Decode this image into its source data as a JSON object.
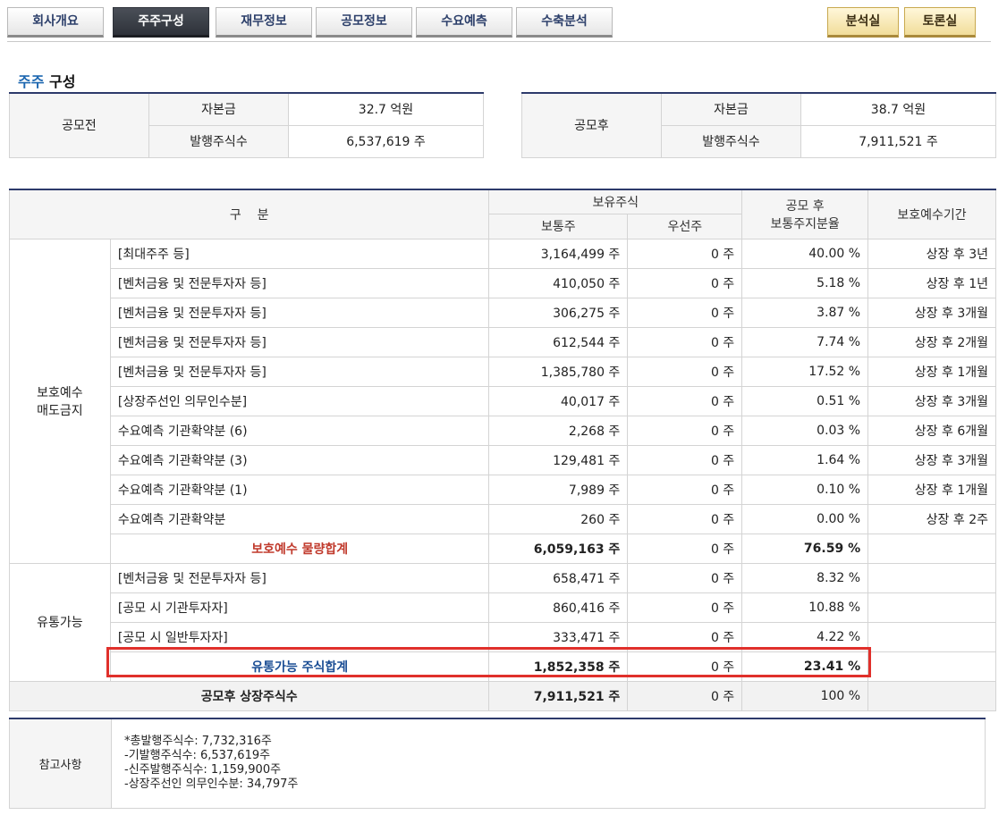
{
  "tabs": {
    "left": [
      "회사개요",
      "주주구성",
      "재무정보",
      "공모정보",
      "수요예측",
      "수축분석"
    ],
    "right": [
      "분석실",
      "토론실"
    ]
  },
  "section": {
    "title_accent": "주주",
    "title_rest": " 구성"
  },
  "before_offering": {
    "label": "공모전",
    "capital_label": "자본금",
    "capital_value": "32.7 억원",
    "shares_label": "발행주식수",
    "shares_value": "6,537,619 주"
  },
  "after_offering": {
    "label": "공모후",
    "capital_label": "자본금",
    "capital_value": "38.7 억원",
    "shares_label": "발행주식수",
    "shares_value": "7,911,521 주"
  },
  "table": {
    "headers": {
      "category": "구    분",
      "holdings": "보유주식",
      "common": "보통주",
      "preferred": "우선주",
      "ratio_line1": "공모 후",
      "ratio_line2": "보통주지분율",
      "lockup": "보호예수기간"
    },
    "lockup_group": {
      "label_line1": "보호예수",
      "label_line2": "매도금지",
      "rows": [
        {
          "name": "[최대주주 등]",
          "common": "3,164,499 주",
          "preferred": "0 주",
          "ratio": "40.00 %",
          "period": "상장 후 3년"
        },
        {
          "name": "[벤처금융 및 전문투자자 등]",
          "common": "410,050 주",
          "preferred": "0 주",
          "ratio": "5.18 %",
          "period": "상장 후 1년"
        },
        {
          "name": "[벤처금융 및 전문투자자 등]",
          "common": "306,275 주",
          "preferred": "0 주",
          "ratio": "3.87 %",
          "period": "상장 후 3개월"
        },
        {
          "name": "[벤처금융 및 전문투자자 등]",
          "common": "612,544 주",
          "preferred": "0 주",
          "ratio": "7.74 %",
          "period": "상장 후 2개월"
        },
        {
          "name": "[벤처금융 및 전문투자자 등]",
          "common": "1,385,780 주",
          "preferred": "0 주",
          "ratio": "17.52 %",
          "period": "상장 후 1개월"
        },
        {
          "name": "[상장주선인 의무인수분]",
          "common": "40,017 주",
          "preferred": "0 주",
          "ratio": "0.51 %",
          "period": "상장 후 3개월"
        },
        {
          "name": "수요예측 기관확약분 (6)",
          "common": "2,268 주",
          "preferred": "0 주",
          "ratio": "0.03 %",
          "period": "상장 후 6개월"
        },
        {
          "name": "수요예측 기관확약분 (3)",
          "common": "129,481 주",
          "preferred": "0 주",
          "ratio": "1.64 %",
          "period": "상장 후 3개월"
        },
        {
          "name": "수요예측 기관확약분 (1)",
          "common": "7,989 주",
          "preferred": "0 주",
          "ratio": "0.10 %",
          "period": "상장 후 1개월"
        },
        {
          "name": "수요예측 기관확약분",
          "common": "260 주",
          "preferred": "0 주",
          "ratio": "0.00 %",
          "period": "상장 후 2주"
        }
      ],
      "subtotal": {
        "name": "보호예수 물량합계",
        "common": "6,059,163 주",
        "preferred": "0 주",
        "ratio": "76.59 %"
      }
    },
    "tradable_group": {
      "label": "유통가능",
      "rows": [
        {
          "name": "[벤처금융 및 전문투자자 등]",
          "common": "658,471 주",
          "preferred": "0 주",
          "ratio": "8.32 %"
        },
        {
          "name": "[공모 시 기관투자자]",
          "common": "860,416 주",
          "preferred": "0 주",
          "ratio": "10.88 %"
        },
        {
          "name": "[공모 시 일반투자자]",
          "common": "333,471 주",
          "preferred": "0 주",
          "ratio": "4.22 %"
        }
      ],
      "subtotal": {
        "name": "유통가능 주식합계",
        "common": "1,852,358 주",
        "preferred": "0 주",
        "ratio": "23.41 %"
      }
    },
    "total": {
      "name": "공모후 상장주식수",
      "common": "7,911,521 주",
      "preferred": "0 주",
      "ratio": "100 %"
    }
  },
  "notes": {
    "label": "참고사항",
    "lines": [
      "*총발행주식수: 7,732,316주",
      "-기발행주식수: 6,537,619주",
      "-신주발행주식수: 1,159,900주",
      "-상장주선인 의무인수분: 34,797주"
    ]
  }
}
